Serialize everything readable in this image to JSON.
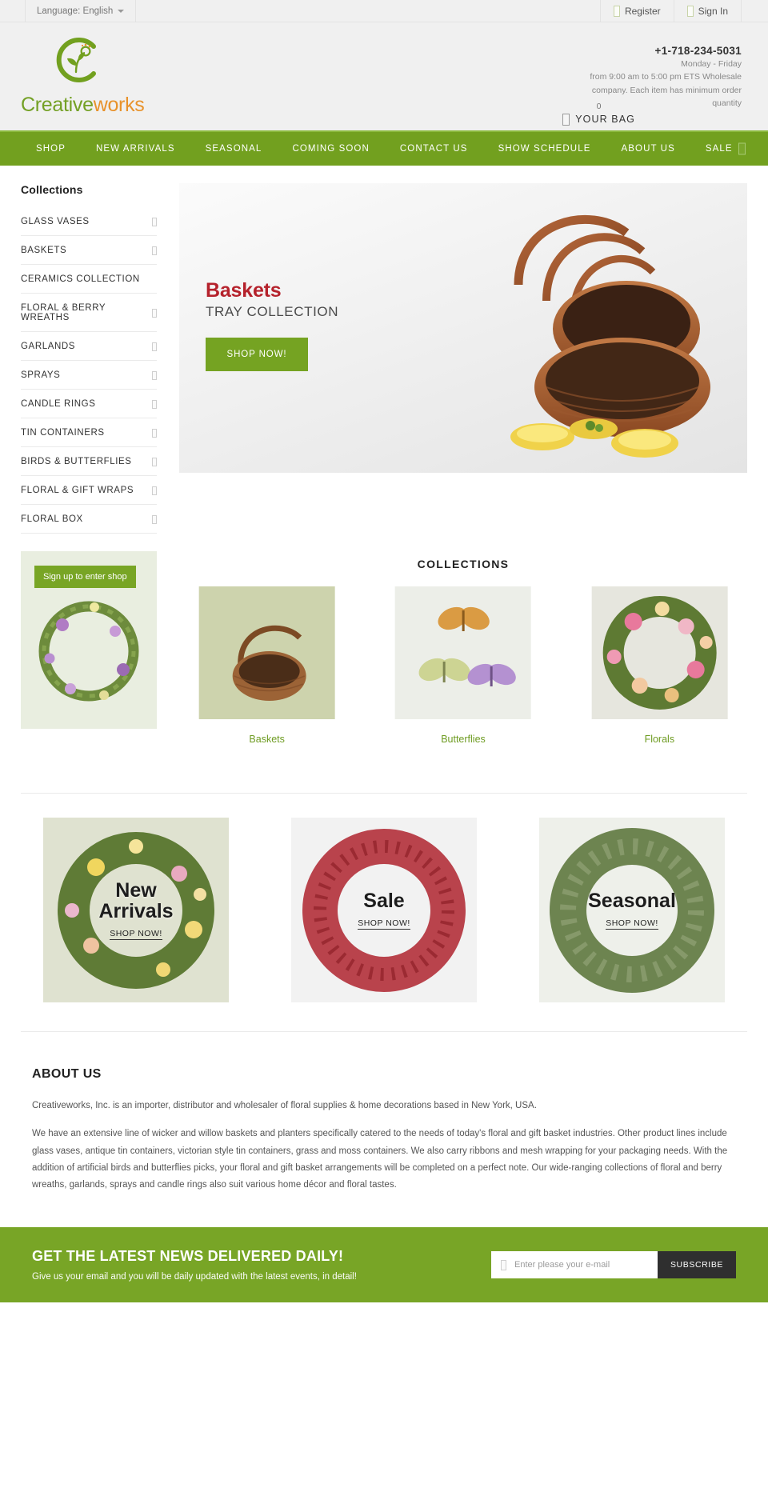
{
  "topbar": {
    "language_label": "Language: English",
    "register": "Register",
    "signin": "Sign In"
  },
  "header": {
    "logo_primary": "Creative",
    "logo_secondary": "works",
    "phone": "+1-718-234-5031",
    "hours_line1": "Monday - Friday",
    "hours_line2": "from 9:00 am to 5:00 pm ETS Wholesale",
    "hours_line3": "company. Each item has minimum order",
    "hours_line4": "quantity",
    "bag_count": "0",
    "bag_label": "YOUR BAG"
  },
  "nav": {
    "items": [
      {
        "label": "SHOP"
      },
      {
        "label": "NEW ARRIVALS"
      },
      {
        "label": "SEASONAL"
      },
      {
        "label": "COMING SOON"
      },
      {
        "label": "CONTACT US"
      },
      {
        "label": "SHOW SCHEDULE"
      },
      {
        "label": "ABOUT US"
      },
      {
        "label": "SALE"
      }
    ]
  },
  "sidebar": {
    "title": "Collections",
    "items": [
      {
        "label": "GLASS VASES"
      },
      {
        "label": "BASKETS"
      },
      {
        "label": "CERAMICS COLLECTION"
      },
      {
        "label": "FLORAL & BERRY WREATHS"
      },
      {
        "label": "GARLANDS"
      },
      {
        "label": "SPRAYS"
      },
      {
        "label": "CANDLE RINGS"
      },
      {
        "label": "TIN CONTAINERS"
      },
      {
        "label": "BIRDS & BUTTERFLIES"
      },
      {
        "label": "FLORAL & GIFT WRAPS"
      },
      {
        "label": "FLORAL BOX"
      }
    ]
  },
  "hero": {
    "title": "Baskets",
    "subtitle": "TRAY COLLECTION",
    "cta": "SHOP NOW!"
  },
  "promo": {
    "badge": "Sign up to enter shop"
  },
  "collections": {
    "heading": "COLLECTIONS",
    "cards": [
      {
        "caption": "Baskets"
      },
      {
        "caption": "Butterflies"
      },
      {
        "caption": "Florals"
      }
    ]
  },
  "banners": [
    {
      "title": "New\nArrivals",
      "link": "SHOP NOW!"
    },
    {
      "title": "Sale",
      "link": "SHOP NOW!"
    },
    {
      "title": "Seasonal",
      "link": "SHOP NOW!"
    }
  ],
  "about": {
    "heading": "ABOUT US",
    "p1": "Creativeworks, Inc. is an importer, distributor and wholesaler of floral supplies & home decorations based in New York, USA.",
    "p2": "We have an extensive line of wicker and willow baskets and planters specifically catered to the needs of today's floral and gift basket industries. Other product lines include glass vases, antique tin containers, victorian style tin containers, grass and moss containers. We also carry ribbons and mesh wrapping for your packaging needs. With the addition of artificial birds and butterflies picks, your floral and gift basket arrangements will be completed on a perfect note. Our wide-ranging collections of floral and berry wreaths, garlands, sprays and candle rings also suit various home décor and floral tastes."
  },
  "newsletter": {
    "heading": "GET THE LATEST NEWS DELIVERED DAILY!",
    "sub": "Give us your email and you will be daily updated with the latest events, in detail!",
    "placeholder": "Enter please your e-mail",
    "button": "SUBSCRIBE"
  },
  "colors": {
    "brand_green": "#72a01f",
    "hero_red": "#b5222c",
    "dark": "#2f2f2f"
  }
}
